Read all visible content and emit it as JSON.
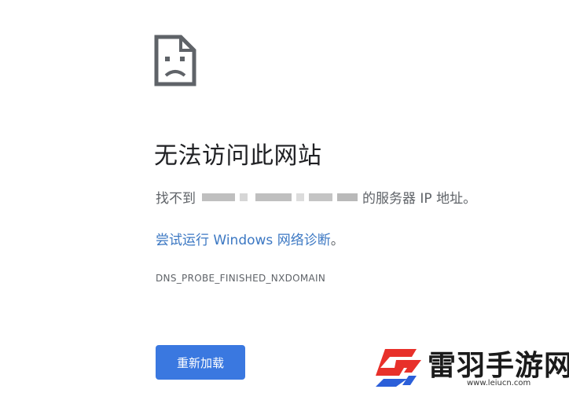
{
  "error": {
    "title": "无法访问此网站",
    "message_prefix": "找不到",
    "message_suffix": "的服务器 IP 地址。",
    "suggestion_link": "尝试运行 Windows 网络诊断",
    "suggestion_end": "。",
    "code": "DNS_PROBE_FINISHED_NXDOMAIN",
    "icon": "sad-page-icon"
  },
  "actions": {
    "reload_label": "重新加载",
    "reload_color": "#3a78e0"
  },
  "watermark": {
    "brand": "雷羽手游网",
    "url": "www.leiucn.com",
    "logo_color": "#e8302a",
    "logo_accent": "#2b5fd9"
  }
}
